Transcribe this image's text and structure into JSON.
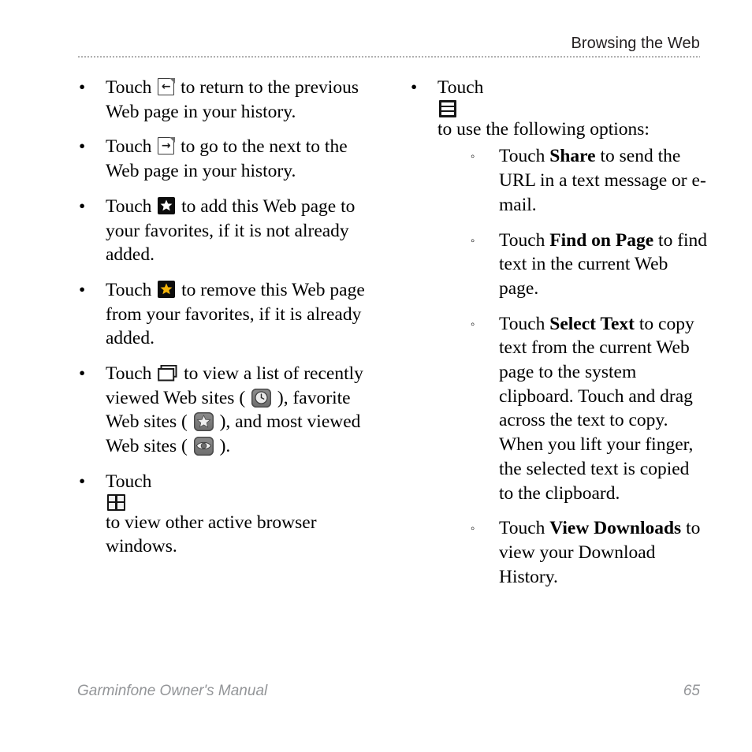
{
  "header": {
    "title": "Browsing the Web"
  },
  "footer": {
    "manual_title": "Garminfone Owner's Manual",
    "page_number": "65",
    "color": "#939598"
  },
  "columns": {
    "left": {
      "bullets": [
        {
          "marker": "•",
          "icon": "back-arrow-page-icon",
          "text_before": "Touch",
          "text_after": "to return to the previous Web page in your history."
        },
        {
          "marker": "•",
          "icon": "forward-arrow-page-icon",
          "text_before": "Touch",
          "text_after": "to go to the next to the Web page in your history."
        },
        {
          "marker": "•",
          "icon": "add-favorite-star-icon",
          "text_before": "Touch",
          "text_after": "to add this Web page to your favorites, if it is not already added."
        },
        {
          "marker": "•",
          "icon": "remove-favorite-star-icon",
          "text_before": "Touch",
          "text_after": "to remove this Web page from your favorites, if it is already added."
        },
        {
          "marker": "•",
          "icon": "bookmarks-folder-icon",
          "text_before": "Touch",
          "segment_1": "to view a list of recently viewed Web sites (",
          "inline_icon_1": "recent-clock-icon",
          "segment_2": "), favorite Web sites (",
          "inline_icon_2": "favorites-star-icon",
          "segment_3": "), and most viewed Web sites (",
          "inline_icon_3": "most-viewed-eye-icon",
          "segment_4": ")."
        },
        {
          "marker": "•",
          "icon": "browser-windows-grid-icon",
          "text_before": "Touch",
          "text_after": "to view other active browser windows."
        }
      ]
    },
    "right": {
      "bullets": [
        {
          "marker": "•",
          "icon": "menu-hamburger-icon",
          "text_before": "Touch",
          "text_after": "to use the following options:",
          "sub_bullets": [
            {
              "marker": "◦",
              "text_before": "Touch",
              "bold_term": "Share",
              "text_after": "to send the URL in a text message or e-mail."
            },
            {
              "marker": "◦",
              "text_before": "Touch",
              "bold_term": "Find on Page",
              "text_after": "to find text in the current Web page."
            },
            {
              "marker": "◦",
              "text_before": "Touch",
              "bold_term": "Select Text",
              "text_after": "to copy text from the current Web page to the system clipboard. Touch and drag across the text to copy. When you lift your finger, the selected text is copied to the clipboard."
            },
            {
              "marker": "◦",
              "text_before": "Touch",
              "bold_term": "View Downloads",
              "text_after": "to view your Download History."
            }
          ]
        }
      ]
    }
  }
}
